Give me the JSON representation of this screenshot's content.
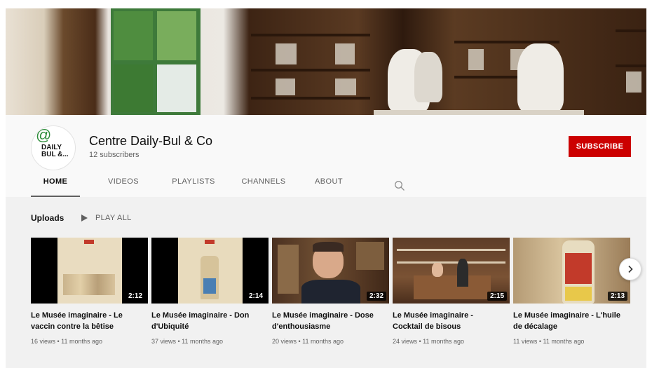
{
  "channel": {
    "name": "Centre Daily-Bul & Co",
    "subscribers": "12 subscribers",
    "avatar_text": "DAILY BUL &...",
    "subscribe_label": "SUBSCRIBE"
  },
  "tabs": [
    {
      "label": "HOME",
      "active": true
    },
    {
      "label": "VIDEOS",
      "active": false
    },
    {
      "label": "PLAYLISTS",
      "active": false
    },
    {
      "label": "CHANNELS",
      "active": false
    },
    {
      "label": "ABOUT",
      "active": false
    }
  ],
  "icons": {
    "search": "search-icon",
    "play": "play-icon",
    "next": "chevron-right-icon"
  },
  "uploads": {
    "title": "Uploads",
    "play_all_label": "PLAY ALL"
  },
  "videos": [
    {
      "title": "Le Musée imaginaire - Le vaccin contre la bêtise",
      "duration": "2:12",
      "meta": "16 views • 11 months ago"
    },
    {
      "title": "Le Musée imaginaire - Don d'Ubiquité",
      "duration": "2:14",
      "meta": "37 views • 11 months ago"
    },
    {
      "title": "Le Musée imaginaire - Dose d'enthousiasme",
      "duration": "2:32",
      "meta": "20 views • 11 months ago"
    },
    {
      "title": "Le Musée imaginaire - Cocktail de bisous",
      "duration": "2:15",
      "meta": "24 views • 11 months ago"
    },
    {
      "title": "Le Musée imaginaire - L'huile de décalage",
      "duration": "2:13",
      "meta": "11 views • 11 months ago"
    }
  ],
  "colors": {
    "subscribe": "#cc0000",
    "header_bg": "#f9f9f9",
    "content_bg": "#f1f1f1"
  }
}
